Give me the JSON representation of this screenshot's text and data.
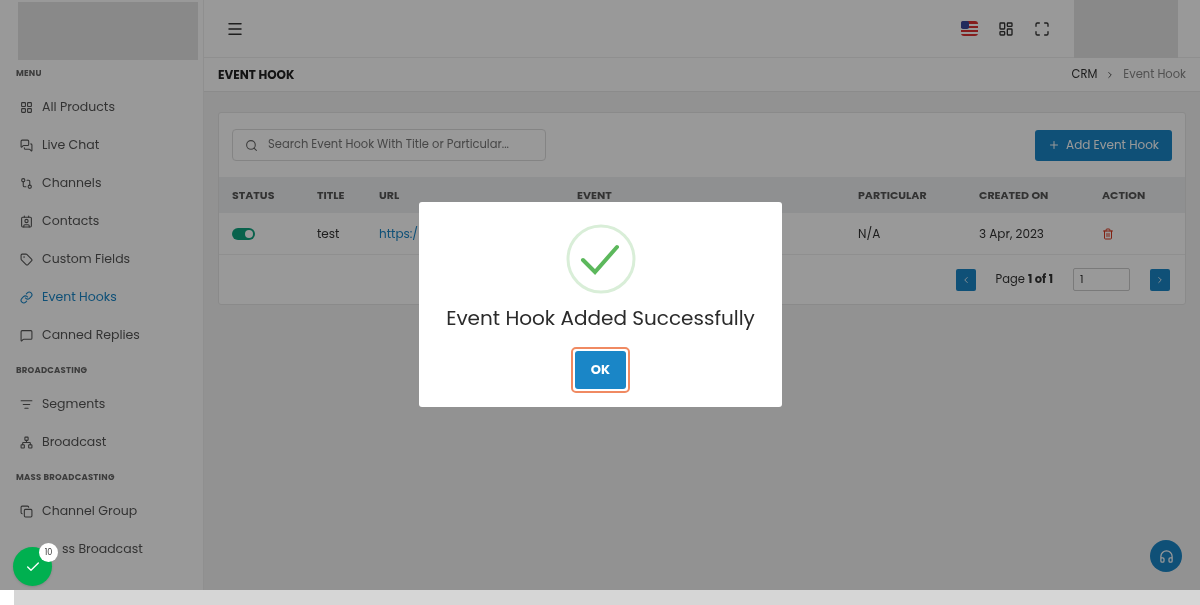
{
  "sidebar": {
    "sections": [
      {
        "heading": "MENU",
        "items": [
          {
            "label": "All Products",
            "selected": false
          },
          {
            "label": "Live Chat",
            "selected": false
          },
          {
            "label": "Channels",
            "selected": false
          },
          {
            "label": "Contacts",
            "selected": false
          },
          {
            "label": "Custom Fields",
            "selected": false
          },
          {
            "label": "Event Hooks",
            "selected": true
          },
          {
            "label": "Canned Replies",
            "selected": false
          }
        ]
      },
      {
        "heading": "BROADCASTING",
        "items": [
          {
            "label": "Segments",
            "selected": false
          },
          {
            "label": "Broadcast",
            "selected": false
          }
        ]
      },
      {
        "heading": "MASS BROADCASTING",
        "items": [
          {
            "label": "Channel Group",
            "selected": false
          },
          {
            "label": "ss Broadcast",
            "selected": false
          }
        ]
      }
    ]
  },
  "page": {
    "title": "EVENT HOOK",
    "breadcrumb": [
      "CRM",
      "Event Hook"
    ]
  },
  "search": {
    "placeholder": "Search Event Hook With Title or Particular..."
  },
  "add_button": "Add Event Hook",
  "table": {
    "columns": [
      "STATUS",
      "TITLE",
      "URL",
      "EVENT",
      "PARTICULAR",
      "CREATED ON",
      "ACTION"
    ],
    "rows": [
      {
        "on": true,
        "title": "test",
        "url": "https:/",
        "particular": "N/A",
        "created_on": "3 Apr, 2023"
      }
    ]
  },
  "pagination": {
    "label": "Page **1 of 1**",
    "value": "1"
  },
  "dialog": {
    "message": "Event Hook Added Successfully",
    "button": "OK"
  },
  "badge": {
    "count": "10"
  }
}
